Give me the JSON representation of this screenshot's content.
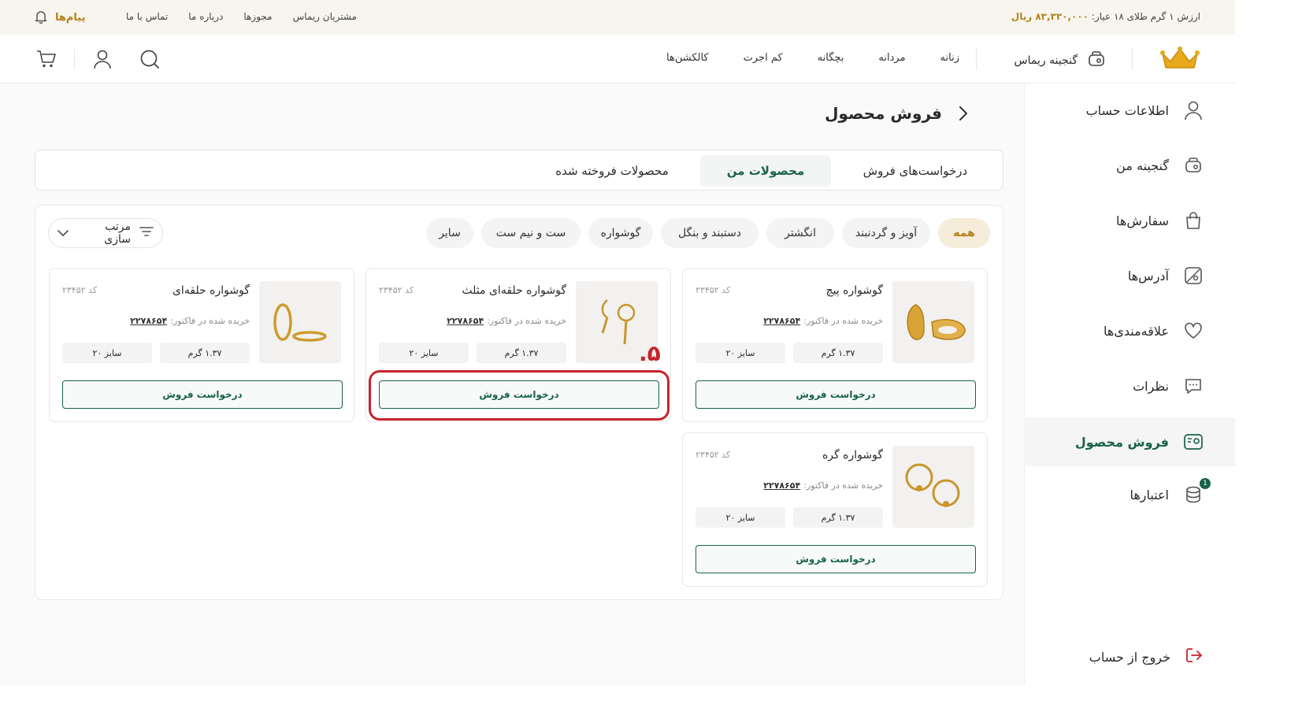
{
  "topbar": {
    "gold_label": "ارزش ۱ گرم طلای ۱۸ عیار:",
    "gold_value": "۸۳,۳۳۰,۰۰۰ ریال",
    "links": [
      "مشتریان ریماس",
      "مجوزها",
      "درباره ما",
      "تماس با ما"
    ],
    "messages_label": "پیام‌ها"
  },
  "header": {
    "treasure_label": "گنجینه ریماس",
    "nav": [
      "زنانه",
      "مردانه",
      "بچگانه",
      "کم اجرت",
      "کالکشن‌ها"
    ]
  },
  "sidebar": {
    "items": [
      {
        "label": "اطلاعات حساب",
        "icon": "user-icon"
      },
      {
        "label": "گنجینه من",
        "icon": "treasure-icon"
      },
      {
        "label": "سفارش‌ها",
        "icon": "bag-icon"
      },
      {
        "label": "آدرس‌ها",
        "icon": "map-icon"
      },
      {
        "label": "علاقه‌مندی‌ها",
        "icon": "heart-icon"
      },
      {
        "label": "نظرات",
        "icon": "chat-icon"
      },
      {
        "label": "فروش محصول",
        "icon": "sell-icon"
      },
      {
        "label": "اعتبارها",
        "icon": "coins-icon",
        "badge": "1"
      }
    ],
    "active": "فروش محصول",
    "logout": "خروج از حساب"
  },
  "page": {
    "title": "فروش محصول",
    "tabs": [
      "درخواست‌های فروش",
      "محصولات من",
      "محصولات فروخته شده"
    ],
    "active_tab": "محصولات من",
    "filters": [
      "همه",
      "آویز و گردنبند",
      "انگشتر",
      "دستبند و بنگل",
      "گوشواره",
      "ست و نیم ست",
      "سایر"
    ],
    "active_filter": "همه",
    "sort_label": "مرتب سازی",
    "step_number": ".۵"
  },
  "products": [
    {
      "name": "گوشواره پیچ",
      "code": "کد ۲۳۴۵۲",
      "invoice_label": "خریده شده در فاکتور:",
      "invoice": "۲۲۷۸۶۵۴",
      "weight": "۱.۳۷ گرم",
      "size": "سایز ۲۰",
      "button": "درخواست فروش"
    },
    {
      "name": "گوشواره حلقه‌ای مثلث",
      "code": "کد ۲۳۴۵۲",
      "invoice_label": "خریده شده در فاکتور:",
      "invoice": "۲۲۷۸۶۵۴",
      "weight": "۱.۳۷ گرم",
      "size": "سایز ۲۰",
      "button": "درخواست فروش"
    },
    {
      "name": "گوشواره حلقه‌ای",
      "code": "کد ۲۳۴۵۲",
      "invoice_label": "خریده شده در فاکتور:",
      "invoice": "۲۲۷۸۶۵۴",
      "weight": "۱.۳۷ گرم",
      "size": "سایز ۲۰",
      "button": "درخواست فروش"
    },
    {
      "name": "گوشواره گره",
      "code": "کد ۲۳۴۵۲",
      "invoice_label": "خریده شده در فاکتور:",
      "invoice": "۲۲۷۸۶۵۴",
      "weight": "۱.۳۷ گرم",
      "size": "سایز ۲۰",
      "button": "درخواست فروش"
    }
  ],
  "colors": {
    "brand_green": "#17624a",
    "gold": "#b5811b",
    "highlight_red": "#c6232b"
  }
}
